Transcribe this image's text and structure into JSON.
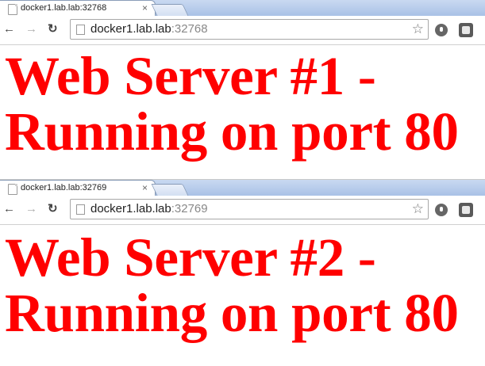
{
  "windows": [
    {
      "tab_title": "docker1.lab.lab:32768",
      "url_host": "docker1.lab.lab",
      "url_port": ":32768",
      "heading": "Web Server #1 -\nRunning on port 80"
    },
    {
      "tab_title": "docker1.lab.lab:32769",
      "url_host": "docker1.lab.lab",
      "url_port": ":32769",
      "heading": "Web Server #2 -\nRunning on port 80"
    }
  ],
  "icons": {
    "back": "←",
    "forward": "→",
    "reload": "↻",
    "close": "×",
    "bookmark_star": "☆"
  },
  "colors": {
    "heading": "#ff0000",
    "tabstrip": "#b9cdea"
  }
}
